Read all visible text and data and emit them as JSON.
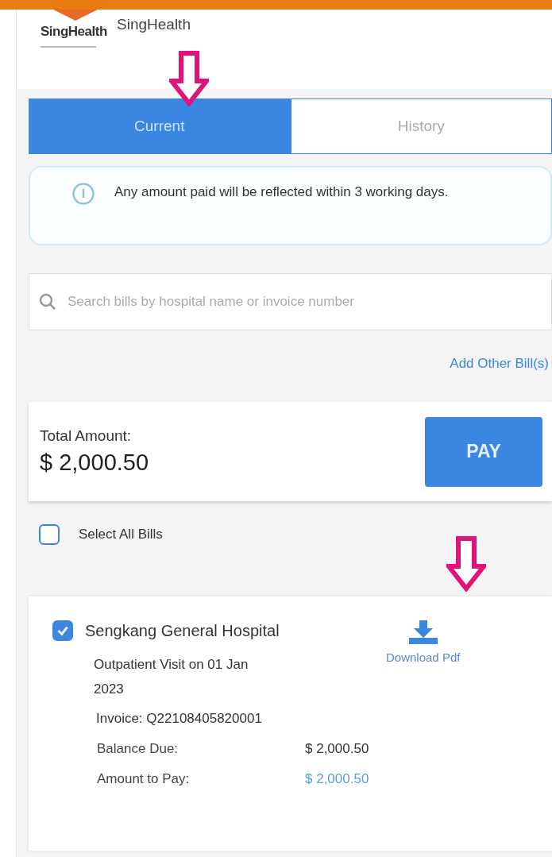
{
  "header": {
    "logo_text": "SingHealth",
    "title": "SingHealth"
  },
  "tabs": [
    {
      "label": "Current",
      "selected": true
    },
    {
      "label": "History",
      "selected": false
    }
  ],
  "notice": {
    "text": "Any amount paid will be reflected within 3 working days."
  },
  "search": {
    "placeholder": "Search bills by hospital name or invoice number"
  },
  "add_link": "Add Other Bill(s)",
  "total": {
    "label": "Total Amount:",
    "amount": "$ 2,000.50",
    "button": "PAY"
  },
  "select_all": {
    "label": "Select All Bills",
    "checked": false
  },
  "bills": [
    {
      "hospital": "Sengkang General Hospital",
      "checked": true,
      "visit": "Outpatient Visit on 01 Jan 2023",
      "invoice": "Invoice: Q22108405820001",
      "download": "Download Pdf",
      "rows": [
        {
          "label": "Balance Due:",
          "value": "$ 2,000.50",
          "kind": "plain"
        },
        {
          "label": "Amount to Pay:",
          "value": "$ 2,000.50",
          "kind": "link"
        }
      ]
    }
  ]
}
